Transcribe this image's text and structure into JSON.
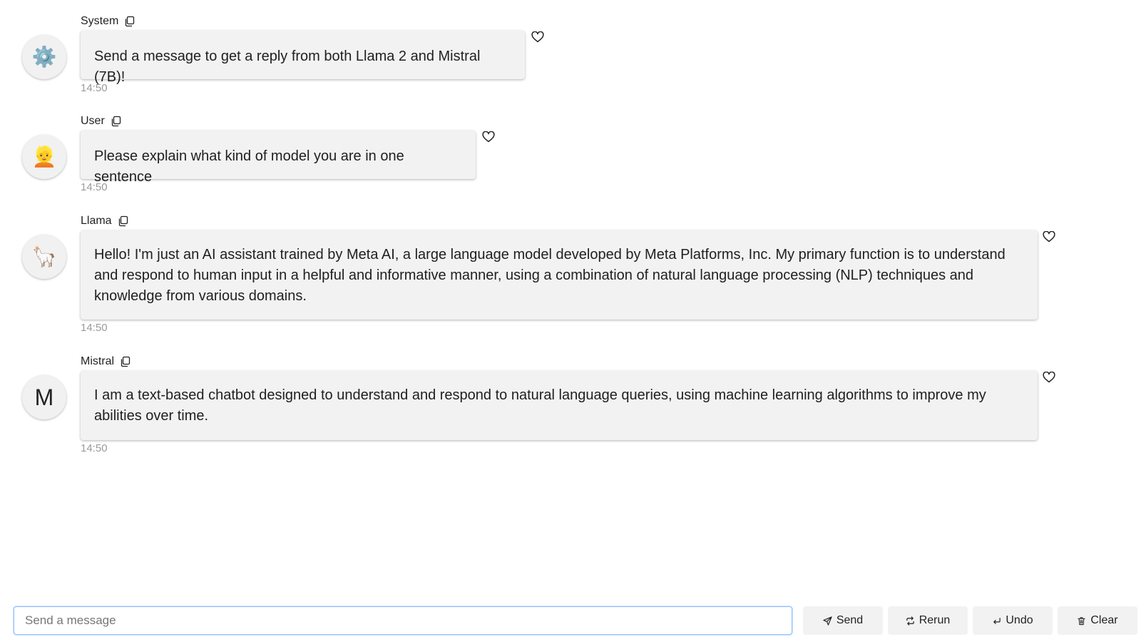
{
  "messages": [
    {
      "sender": "System",
      "avatar": "⚙️",
      "avatar_icon": "gear-icon",
      "text": "Send a message to get a reply from both Llama 2 and Mistral (7B)!",
      "time": "14:50"
    },
    {
      "sender": "User",
      "avatar": "👱",
      "avatar_icon": "person-blond-icon",
      "text": "Please explain what kind of model you are in one sentence",
      "time": "14:50"
    },
    {
      "sender": "Llama",
      "avatar": "🦙",
      "avatar_icon": "llama-icon",
      "text": "Hello! I'm just an AI assistant trained by Meta AI, a large language model developed by Meta Platforms, Inc. My primary function is to understand and respond to human input in a helpful and informative manner, using a combination of natural language processing (NLP) techniques and knowledge from various domains.",
      "time": "14:50"
    },
    {
      "sender": "Mistral",
      "avatar": "M",
      "avatar_icon": "letter-avatar",
      "text": "I am a text-based chatbot designed to understand and respond to natural language queries, using machine learning algorithms to improve my abilities over time.",
      "time": "14:50"
    }
  ],
  "composer": {
    "placeholder": "Send a message",
    "value": "",
    "buttons": {
      "send": "Send",
      "rerun": "Rerun",
      "undo": "Undo",
      "clear": "Clear"
    }
  },
  "colors": {
    "bubble_bg": "#f2f2f2",
    "timestamp": "#9a9a9a",
    "input_border": "#8ec3ff"
  }
}
